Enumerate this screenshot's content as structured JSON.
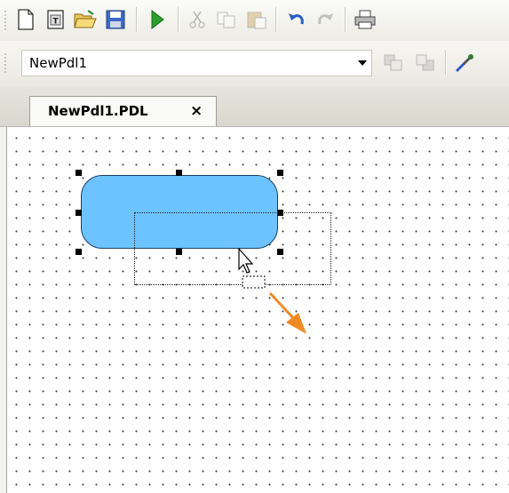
{
  "toolbar": {
    "icons": [
      "new-icon",
      "template-icon",
      "open-folder-icon",
      "save-icon",
      "run-icon",
      "cut-icon",
      "copy-icon",
      "paste-icon",
      "undo-icon",
      "redo-icon",
      "print-icon"
    ]
  },
  "toolbar2": {
    "combo_value": "NewPdl1",
    "icons": [
      "bring-front-icon",
      "send-back-icon",
      "eyedropper-icon"
    ]
  },
  "tab": {
    "title": "NewPdl1.PDL",
    "close": "×"
  },
  "canvas": {
    "shape_fill": "#6cc3ff",
    "arrow_color": "#f08a25"
  }
}
